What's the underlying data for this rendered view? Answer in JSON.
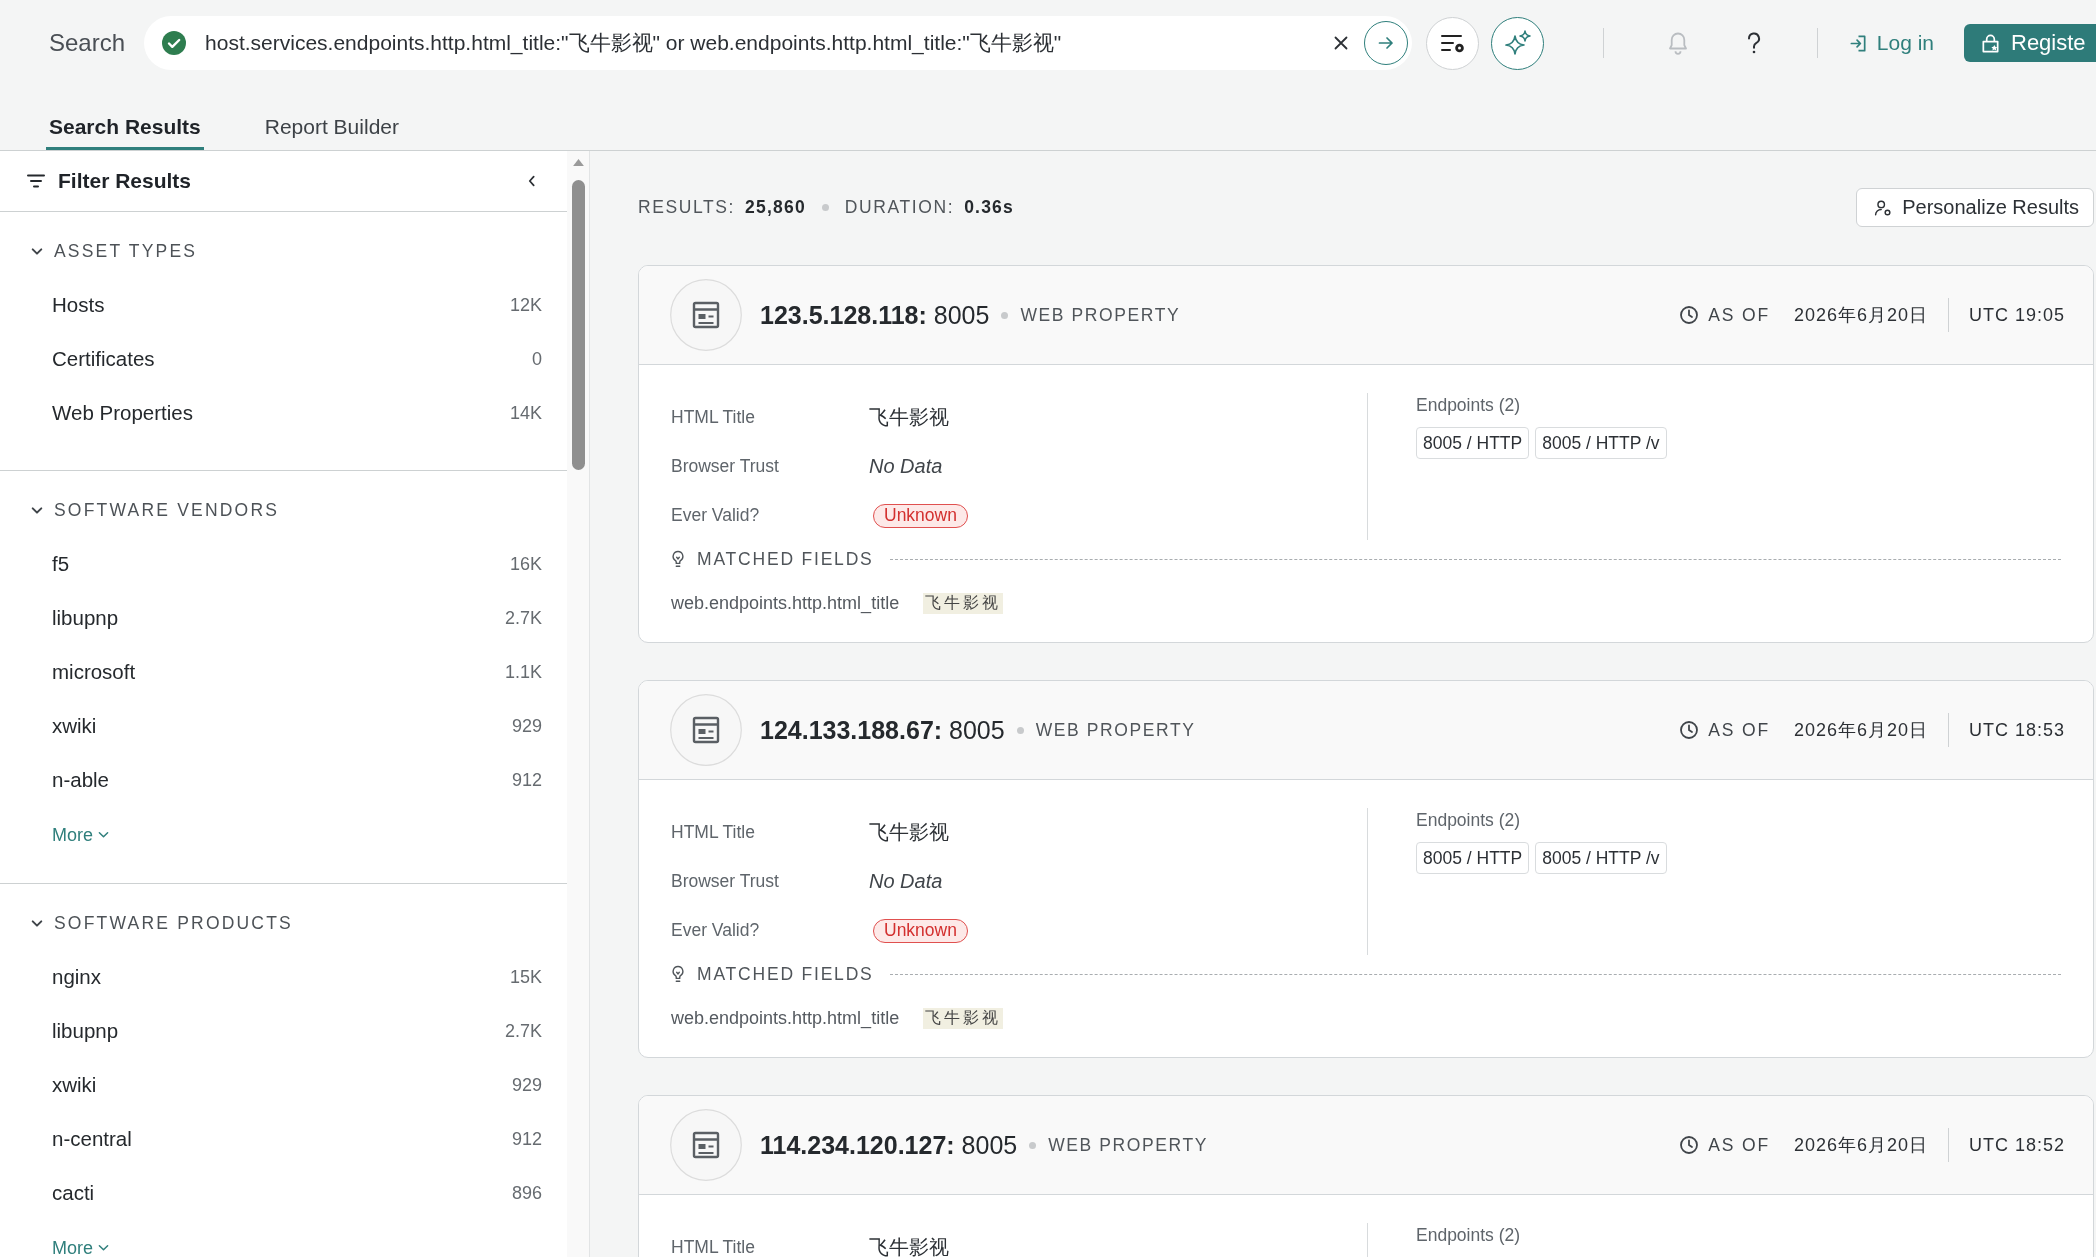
{
  "search": {
    "label": "Search",
    "query": "host.services.endpoints.http.html_title:\"飞牛影视\" or web.endpoints.http.html_title:\"飞牛影视\""
  },
  "account": {
    "login": "Log in",
    "register": "Registe"
  },
  "tabs": [
    {
      "label": "Search Results",
      "selected": true
    },
    {
      "label": "Report Builder",
      "selected": false
    }
  ],
  "filter_panel": {
    "title": "Filter Results",
    "sections": [
      {
        "title": "ASSET TYPES",
        "expanded": true,
        "items": [
          {
            "label": "Hosts",
            "count": "12K"
          },
          {
            "label": "Certificates",
            "count": "0"
          },
          {
            "label": "Web Properties",
            "count": "14K"
          }
        ]
      },
      {
        "title": "SOFTWARE VENDORS",
        "expanded": true,
        "items": [
          {
            "label": "f5",
            "count": "16K"
          },
          {
            "label": "libupnp",
            "count": "2.7K"
          },
          {
            "label": "microsoft",
            "count": "1.1K"
          },
          {
            "label": "xwiki",
            "count": "929"
          },
          {
            "label": "n-able",
            "count": "912"
          }
        ],
        "more": "More"
      },
      {
        "title": "SOFTWARE PRODUCTS",
        "expanded": true,
        "items": [
          {
            "label": "nginx",
            "count": "15K"
          },
          {
            "label": "libupnp",
            "count": "2.7K"
          },
          {
            "label": "xwiki",
            "count": "929"
          },
          {
            "label": "n-central",
            "count": "912"
          },
          {
            "label": "cacti",
            "count": "896"
          }
        ],
        "more": "More"
      }
    ]
  },
  "summary": {
    "results_label": "RESULTS:",
    "results": "25,860",
    "duration_label": "DURATION:",
    "duration": "0.36s",
    "personalize": "Personalize Results"
  },
  "results": [
    {
      "title": "**123.5.128.118:** 8005",
      "type": "WEB PROPERTY",
      "as_of": "AS OF",
      "date": "2026年6月20日",
      "time": "UTC 19:05",
      "fields": [
        {
          "label": "HTML Title",
          "value": "飞牛影视",
          "kind": "text"
        },
        {
          "label": "Browser Trust",
          "value": "No Data",
          "kind": "missing"
        },
        {
          "label": "Ever Valid?",
          "value": "Unknown",
          "kind": "badge"
        }
      ],
      "endpoints_label": "Endpoints (2)",
      "endpoints": [
        "8005 / HTTP",
        "8005 / HTTP /v"
      ],
      "matched_label": "MATCHED FIELDS",
      "matched": [
        {
          "field": "web.endpoints.http.html_title",
          "value": "飞牛影视"
        }
      ]
    },
    {
      "title": "**124.133.188.67:** 8005",
      "type": "WEB PROPERTY",
      "as_of": "AS OF",
      "date": "2026年6月20日",
      "time": "UTC 18:53",
      "fields": [
        {
          "label": "HTML Title",
          "value": "飞牛影视",
          "kind": "text"
        },
        {
          "label": "Browser Trust",
          "value": "No Data",
          "kind": "missing"
        },
        {
          "label": "Ever Valid?",
          "value": "Unknown",
          "kind": "badge"
        }
      ],
      "endpoints_label": "Endpoints (2)",
      "endpoints": [
        "8005 / HTTP",
        "8005 / HTTP /v"
      ],
      "matched_label": "MATCHED FIELDS",
      "matched": [
        {
          "field": "web.endpoints.http.html_title",
          "value": "飞牛影视"
        }
      ]
    },
    {
      "title": "**114.234.120.127:** 8005",
      "type": "WEB PROPERTY",
      "as_of": "AS OF",
      "date": "2026年6月20日",
      "time": "UTC 18:52",
      "fields": [
        {
          "label": "HTML Title",
          "value": "飞牛影视",
          "kind": "text"
        }
      ],
      "endpoints_label": "Endpoints (2)"
    }
  ]
}
